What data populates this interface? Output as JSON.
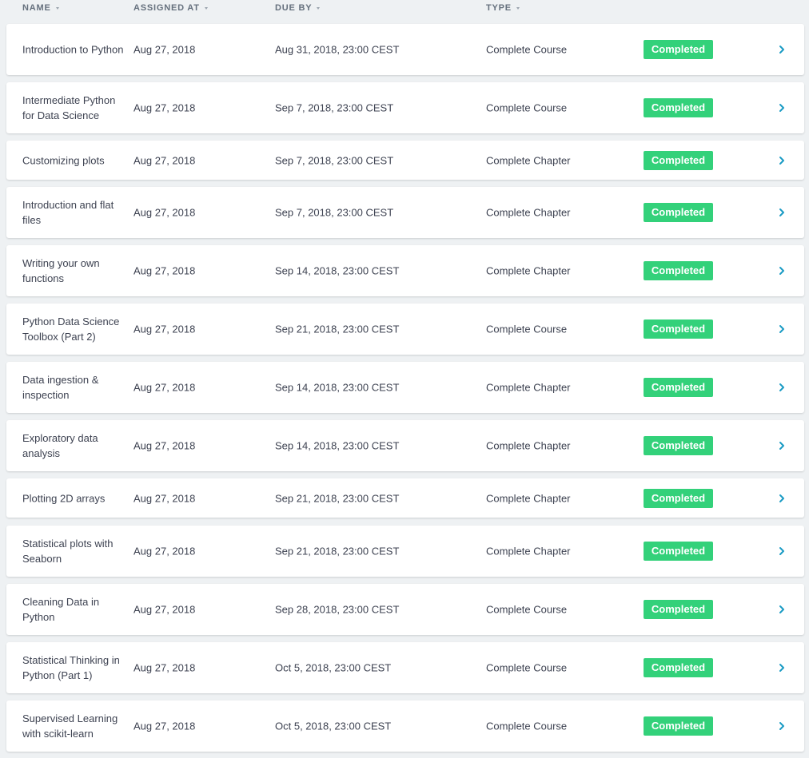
{
  "header": {
    "name": "NAME",
    "assigned_at": "ASSIGNED AT",
    "due_by": "DUE BY",
    "type": "TYPE"
  },
  "colors": {
    "badge": "#33d17a",
    "chevron": "#1a9bc4",
    "background": "#eef1f3"
  },
  "rows": [
    {
      "name": "Introduction to Python",
      "assigned": "Aug 27, 2018",
      "due": "Aug 31, 2018, 23:00 CEST",
      "type": "Complete Course",
      "status": "Completed"
    },
    {
      "name": "Intermediate Python for Data Science",
      "assigned": "Aug 27, 2018",
      "due": "Sep 7, 2018, 23:00 CEST",
      "type": "Complete Course",
      "status": "Completed"
    },
    {
      "name": "Customizing plots",
      "assigned": "Aug 27, 2018",
      "due": "Sep 7, 2018, 23:00 CEST",
      "type": "Complete Chapter",
      "status": "Completed"
    },
    {
      "name": "Introduction and flat files",
      "assigned": "Aug 27, 2018",
      "due": "Sep 7, 2018, 23:00 CEST",
      "type": "Complete Chapter",
      "status": "Completed"
    },
    {
      "name": "Writing your own functions",
      "assigned": "Aug 27, 2018",
      "due": "Sep 14, 2018, 23:00 CEST",
      "type": "Complete Chapter",
      "status": "Completed"
    },
    {
      "name": "Python Data Science Toolbox (Part 2)",
      "assigned": "Aug 27, 2018",
      "due": "Sep 21, 2018, 23:00 CEST",
      "type": "Complete Course",
      "status": "Completed"
    },
    {
      "name": "Data ingestion & inspection",
      "assigned": "Aug 27, 2018",
      "due": "Sep 14, 2018, 23:00 CEST",
      "type": "Complete Chapter",
      "status": "Completed"
    },
    {
      "name": "Exploratory data analysis",
      "assigned": "Aug 27, 2018",
      "due": "Sep 14, 2018, 23:00 CEST",
      "type": "Complete Chapter",
      "status": "Completed"
    },
    {
      "name": "Plotting 2D arrays",
      "assigned": "Aug 27, 2018",
      "due": "Sep 21, 2018, 23:00 CEST",
      "type": "Complete Chapter",
      "status": "Completed"
    },
    {
      "name": "Statistical plots with Seaborn",
      "assigned": "Aug 27, 2018",
      "due": "Sep 21, 2018, 23:00 CEST",
      "type": "Complete Chapter",
      "status": "Completed"
    },
    {
      "name": "Cleaning Data in Python",
      "assigned": "Aug 27, 2018",
      "due": "Sep 28, 2018, 23:00 CEST",
      "type": "Complete Course",
      "status": "Completed"
    },
    {
      "name": "Statistical Thinking in Python (Part 1)",
      "assigned": "Aug 27, 2018",
      "due": "Oct 5, 2018, 23:00 CEST",
      "type": "Complete Course",
      "status": "Completed"
    },
    {
      "name": "Supervised Learning with scikit-learn",
      "assigned": "Aug 27, 2018",
      "due": "Oct 5, 2018, 23:00 CEST",
      "type": "Complete Course",
      "status": "Completed"
    }
  ]
}
